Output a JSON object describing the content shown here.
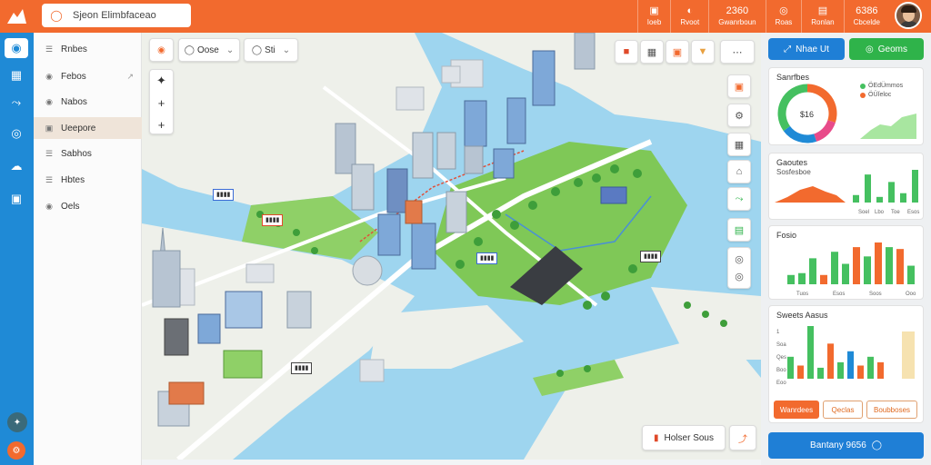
{
  "header": {
    "search_value": "Sjeon Elimbfaceao",
    "stats": [
      {
        "icon": "▣",
        "label": "Ioeb"
      },
      {
        "icon": "◐",
        "label": "Rvoot"
      },
      {
        "icon": "2360",
        "label": "Gwanrboun"
      },
      {
        "icon": "◎",
        "label": "Roas"
      },
      {
        "icon": "▤",
        "label": "Ronlan"
      },
      {
        "icon": "6386",
        "label": "Cbcelde"
      }
    ]
  },
  "sidebar": {
    "items": [
      {
        "label": "Rnbes",
        "icon": "☰"
      },
      {
        "label": "Febos",
        "icon": "◉"
      },
      {
        "label": "Nabos",
        "icon": "◉"
      },
      {
        "label": "Ueepore",
        "icon": "▣"
      },
      {
        "label": "Sabhos",
        "icon": "☰"
      },
      {
        "label": "Hbtes",
        "icon": "☰"
      },
      {
        "label": "Oels",
        "icon": "◉"
      }
    ]
  },
  "map": {
    "filter1": "Oose",
    "filter2": "Sti",
    "bottom_label": "Holser Sous",
    "zoom_in": "+",
    "zoom_out": "+",
    "locate": "✦"
  },
  "panel": {
    "btn_primary": "Nhae Ut",
    "btn_green": "Geoms",
    "card1": {
      "title": "Sanrfbes",
      "center": "$16",
      "legend": [
        "ÖEdÜmmos",
        "ÖÜÏeloc"
      ]
    },
    "card2": {
      "title": "Gaoutes",
      "subtitle": "Sosfesboe",
      "ticks": [
        "Soel",
        "Lbo",
        "Toe",
        "Esos"
      ]
    },
    "card3": {
      "title": "Fosio",
      "ticks": [
        "Tuos",
        "Esos",
        "Soos",
        "Ooo"
      ]
    },
    "card4": {
      "title": "Sweets Aasus",
      "ticks": [
        "1",
        "Soa",
        "Qes",
        "Boo",
        "Eoo"
      ]
    },
    "tabs": [
      "Wanrdees",
      "Qeclas",
      "Boubboses"
    ],
    "big_button": "Bantany 9656"
  },
  "chart_data": [
    {
      "type": "pie",
      "title": "Sanrfbes",
      "values": [
        30,
        15,
        20,
        35
      ],
      "colors": [
        "#f26a2e",
        "#e84b8a",
        "#1f8ad6",
        "#45c060"
      ]
    },
    {
      "type": "bar",
      "title": "Gaoutes",
      "values": [
        8,
        30,
        6,
        22,
        10,
        35
      ],
      "colors": [
        "#45c060",
        "#45c060",
        "#45c060",
        "#45c060",
        "#45c060",
        "#45c060"
      ]
    },
    {
      "type": "bar",
      "title": "Fosio",
      "values": [
        10,
        12,
        28,
        10,
        35,
        22,
        40,
        30,
        45,
        40,
        38,
        20
      ],
      "colors": [
        "#45c060",
        "#45c060",
        "#45c060",
        "#f26a2e",
        "#45c060",
        "#45c060",
        "#f26a2e",
        "#45c060",
        "#f26a2e",
        "#45c060",
        "#f26a2e",
        "#45c060"
      ]
    },
    {
      "type": "bar",
      "title": "Sweets Aasus",
      "values": [
        20,
        12,
        48,
        10,
        32,
        15,
        25,
        12,
        20,
        15
      ],
      "colors": [
        "#45c060",
        "#f26a2e",
        "#45c060",
        "#45c060",
        "#f26a2e",
        "#45c060",
        "#1f8ad6",
        "#f26a2e",
        "#45c060",
        "#f26a2e"
      ]
    }
  ]
}
